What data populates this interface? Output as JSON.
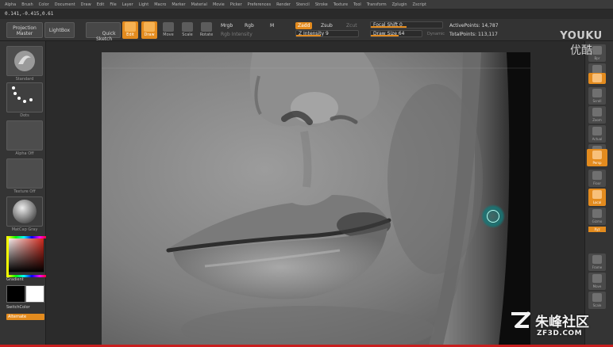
{
  "menu": [
    "Alpha",
    "Brush",
    "Color",
    "Document",
    "Draw",
    "Edit",
    "File",
    "Layer",
    "Light",
    "Macro",
    "Marker",
    "Material",
    "Movie",
    "Picker",
    "Preferences",
    "Render",
    "Stencil",
    "Stroke",
    "Texture",
    "Tool",
    "Transform",
    "Zplugin",
    "Zscript"
  ],
  "coords": "0.141,-0.415,0.61",
  "shelf": {
    "projection_master": "Projection\nMaster",
    "lightbox": "LightBox",
    "quick_sketch": "Quick\nSketch",
    "tools": [
      "Edit",
      "Draw",
      "Move",
      "Scale",
      "Rotate"
    ],
    "mrgb": "Mrgb",
    "rgb": "Rgb",
    "m": "M",
    "rgb_intensity": "Rgb Intensity",
    "zadd": "Zadd",
    "zsub": "Zsub",
    "zcut": "Zcut",
    "z_intensity": "Z Intensity 9",
    "focal_shift": "Focal Shift 0",
    "draw_size": "Draw Size 64",
    "dynamic": "Dynamic",
    "active_points": "ActivePoints: 14,787",
    "total_points": "TotalPoints: 113,117"
  },
  "left": {
    "brush_label": "Standard",
    "stroke_label": "Dots",
    "alpha_label": "Alpha Off",
    "texture_label": "Texture Off",
    "material_label": "MatCap Gray",
    "gradient": "Gradient",
    "switch_color": "SwitchColor",
    "alternate": "Alternate"
  },
  "right": {
    "buttons": [
      "Bpr",
      "SPix",
      "Scroll",
      "Zoom",
      "Actual",
      "AAHalf",
      "Persp",
      "Floor",
      "Local",
      "Gizmo",
      "Frame",
      "Move",
      "Scale"
    ],
    "tag": "Xyz"
  },
  "watermark": {
    "youku": "YOUKU",
    "youku_cn": "优酷",
    "zf3d_name": "朱峰社区",
    "zf3d_site": "ZF3D.COM"
  },
  "colors": {
    "accent": "#e38b1e",
    "cursor": "#3cc8be"
  }
}
